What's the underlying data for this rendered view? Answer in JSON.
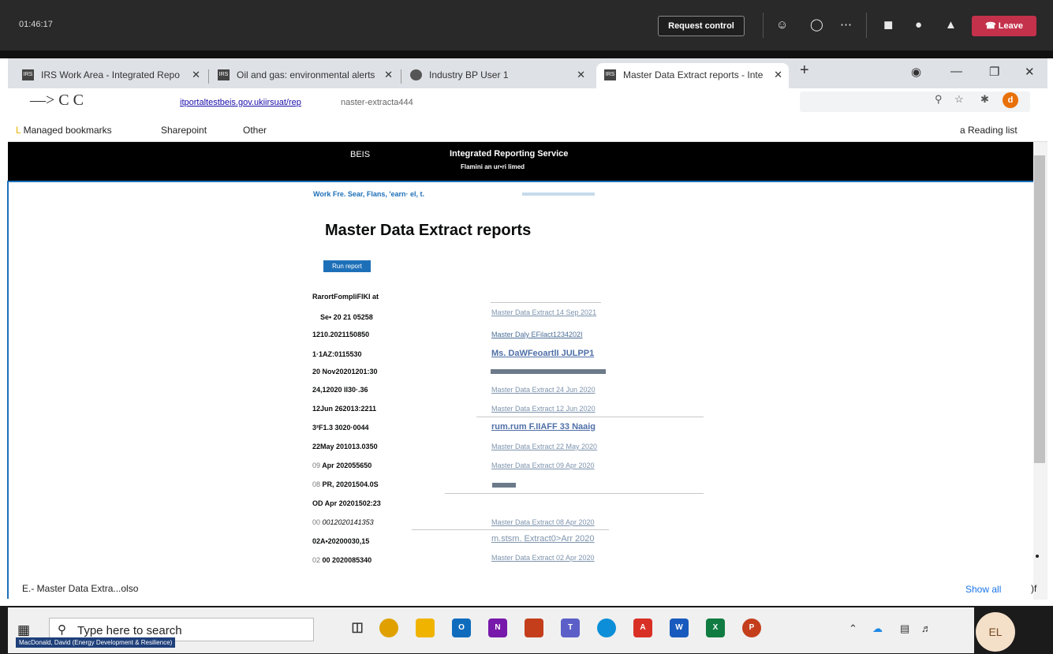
{
  "teams": {
    "time": "01:46:17",
    "request_control": "Request control",
    "leave": "Leave",
    "icons": [
      "people-icon",
      "chat-icon",
      "more-icon",
      "camera-off-icon",
      "mic-icon",
      "share-icon"
    ]
  },
  "browser": {
    "tabs": [
      {
        "label": "IRS Work Area - Integrated Repo"
      },
      {
        "label": "Oil and gas: environmental alerts"
      },
      {
        "label": "Industry BP User 1"
      },
      {
        "label": "Master Data Extract reports - Inte"
      }
    ],
    "nav_text": "—> C C",
    "url_link": "itportaltestbeis.gov.ukiirsuat/rep",
    "url_rest": "naster-extracta444",
    "profile_initial": "d",
    "bookmarks": {
      "managed": "Managed bookmarks",
      "sharepoint": "Sharepoint",
      "other": "Other",
      "reading_list": "a Reading list"
    }
  },
  "header": {
    "org": "BEIS",
    "service": "Integrated Reporting Service",
    "subtitle": "Flamini an ur•ri limed"
  },
  "breadcrumb": "Work Fre. Sear, Flans, 'earn·                        el, t.",
  "page_title": "Master Data Extract reports",
  "run_report": "Run report",
  "reports_header": "RarortFompliFIKI at",
  "reports": [
    {
      "prefix": "",
      "date": "Se• 20 21 05258",
      "link": "Master Data Extract 14 Sep 2021",
      "style": "faded"
    },
    {
      "prefix": "",
      "date": "1210.2021150850",
      "link": "Master Daly EFilact1234202I",
      "style": "normal"
    },
    {
      "prefix": "",
      "date": "1·1AZ:0115530",
      "link": "Ms. DaWFeoartlI JULPP1",
      "style": "big"
    },
    {
      "prefix": "",
      "date": "20 Nov20201201:30",
      "link": "",
      "style": "bar"
    },
    {
      "prefix": "",
      "date": "24,12020 II30·.36",
      "link": "Master Data Extract 24 Jun 2020",
      "style": "faded"
    },
    {
      "prefix": "",
      "date": "12Jun 262013:2211",
      "link": "Master Data Extract 12 Jun 2020",
      "style": "faded"
    },
    {
      "prefix": "",
      "date": "3²F1.3 3020·0044",
      "link": "rum.rum F.IIAFF 33 Naaig",
      "style": "big"
    },
    {
      "prefix": "",
      "date": "22May 201013.0350",
      "link": "Master Data Extract 22 May 2020",
      "style": "faded"
    },
    {
      "prefix": "09",
      "date": "Apr 202055650",
      "link": "Master Data Extract 09 Apr 2020",
      "style": "faded"
    },
    {
      "prefix": "08",
      "date": "PR, 20201504.0S",
      "link": "",
      "style": "smallbar"
    },
    {
      "prefix": "",
      "date": "OD Apr 20201502:23",
      "link": "",
      "style": "none"
    },
    {
      "prefix": "00",
      "date": "0012020141353",
      "link": "Master Data Extract 08 Apr 2020",
      "style": "faded"
    },
    {
      "prefix": "",
      "date": "02A•20200030,15",
      "link": "m.stsm. Extract0>Arr 2020",
      "style": "big"
    },
    {
      "prefix": "02",
      "date": "00 2020085340",
      "link": "Master Data Extract 02 Apr 2020",
      "style": "faded"
    }
  ],
  "download": {
    "file": "E.- Master Data Extra...olso",
    "show_all": "Show all",
    "close": ")f"
  },
  "taskbar": {
    "search_placeholder": "Type here to search",
    "user_initials": "EL",
    "name_label": "MacDonald, David (Energy Development & Resilience)"
  }
}
